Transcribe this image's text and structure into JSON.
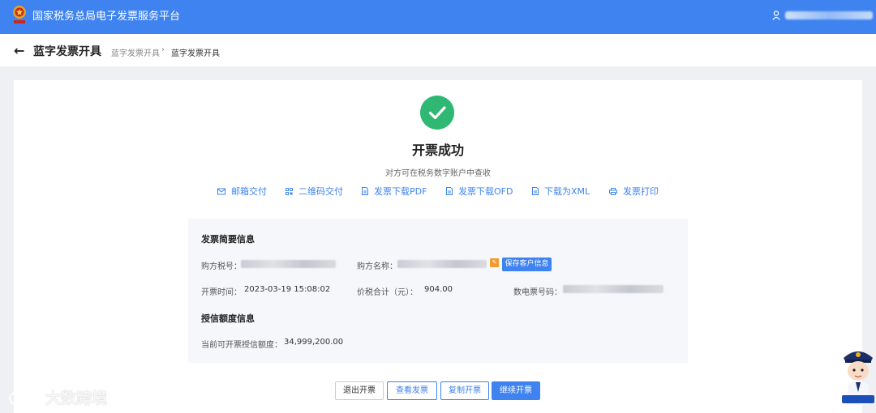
{
  "topbar": {
    "title": "国家税务总局电子发票服务平台"
  },
  "pagehead": {
    "title": "蓝字发票开具",
    "breadcrumb": [
      "蓝字发票开具",
      "蓝字发票开具"
    ]
  },
  "result": {
    "title": "开票成功",
    "subtitle": "对方可在税务数字账户中查收"
  },
  "actions": [
    {
      "label": "邮箱交付",
      "icon": "mail-icon"
    },
    {
      "label": "二维码交付",
      "icon": "qrcode-icon"
    },
    {
      "label": "发票下载PDF",
      "icon": "pdf-download-icon"
    },
    {
      "label": "发票下载OFD",
      "icon": "ofd-download-icon"
    },
    {
      "label": "下载为XML",
      "icon": "xml-download-icon"
    },
    {
      "label": "发票打印",
      "icon": "printer-icon"
    }
  ],
  "summary": {
    "title": "发票简要信息",
    "buyer_tax_id_label": "购方税号：",
    "buyer_name_label": "购方名称：",
    "save_customer_label": "保存客户信息",
    "issue_time_label": "开票时间：",
    "issue_time": "2023-03-19 15:08:02",
    "total_label": "价税合计（元）：",
    "total": "904.00",
    "invoice_no_label": "数电票号码："
  },
  "credit": {
    "title": "授信额度信息",
    "available_label": "当前可开票授信额度：",
    "available": "34,999,200.00"
  },
  "buttons": {
    "exit": "退出开票",
    "view": "查看发票",
    "copy": "复制开票",
    "next": "继续开票"
  },
  "watermark": {
    "text": "大数跨境"
  },
  "colors": {
    "primary": "#3e83f0",
    "success": "#2eb873",
    "warning": "#f29a2e"
  }
}
